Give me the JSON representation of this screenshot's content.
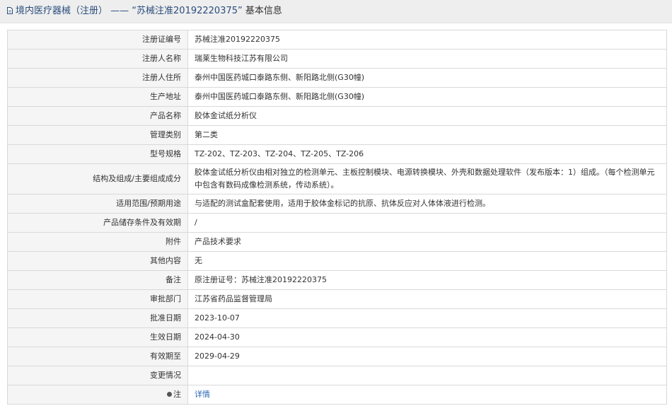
{
  "header": {
    "category": "境内医疗器械（注册）",
    "separator": "——",
    "record_title": "“苏械注准20192220375”",
    "suffix": "基本信息"
  },
  "rows": [
    {
      "label": "注册证编号",
      "value": "苏械注准20192220375"
    },
    {
      "label": "注册人名称",
      "value": "瑞莱生物科技江苏有限公司"
    },
    {
      "label": "注册人住所",
      "value": "泰州中国医药城口泰路东侧、新阳路北侧(G30幢)"
    },
    {
      "label": "生产地址",
      "value": "泰州中国医药城口泰路东侧、新阳路北侧(G30幢)"
    },
    {
      "label": "产品名称",
      "value": "胶体金试纸分析仪"
    },
    {
      "label": "管理类别",
      "value": "第二类"
    },
    {
      "label": "型号规格",
      "value": "TZ-202、TZ-203、TZ-204、TZ-205、TZ-206"
    },
    {
      "label": "结构及组成/主要组成成分",
      "value": "胶体金试纸分析仪由相对独立的检测单元、主板控制模块、电源转换模块、外壳和数据处理软件（发布版本：1）组成。（每个检测单元中包含有数码成像检测系统，传动系统）。"
    },
    {
      "label": "适用范围/预期用途",
      "value": "与适配的测试盒配套使用，适用于胶体金标记的抗原、抗体反应对人体体液进行检测。"
    },
    {
      "label": "产品储存条件及有效期",
      "value": "/"
    },
    {
      "label": "附件",
      "value": "产品技术要求"
    },
    {
      "label": "其他内容",
      "value": "无"
    },
    {
      "label": "备注",
      "value": "原注册证号：苏械注准20192220375"
    },
    {
      "label": "审批部门",
      "value": "江苏省药品监督管理局"
    },
    {
      "label": "批准日期",
      "value": "2023-10-07"
    },
    {
      "label": "生效日期",
      "value": "2024-04-30"
    },
    {
      "label": "有效期至",
      "value": "2029-04-29"
    },
    {
      "label": "变更情况",
      "value": ""
    }
  ],
  "note_row": {
    "label": "注",
    "link_text": "详情"
  }
}
